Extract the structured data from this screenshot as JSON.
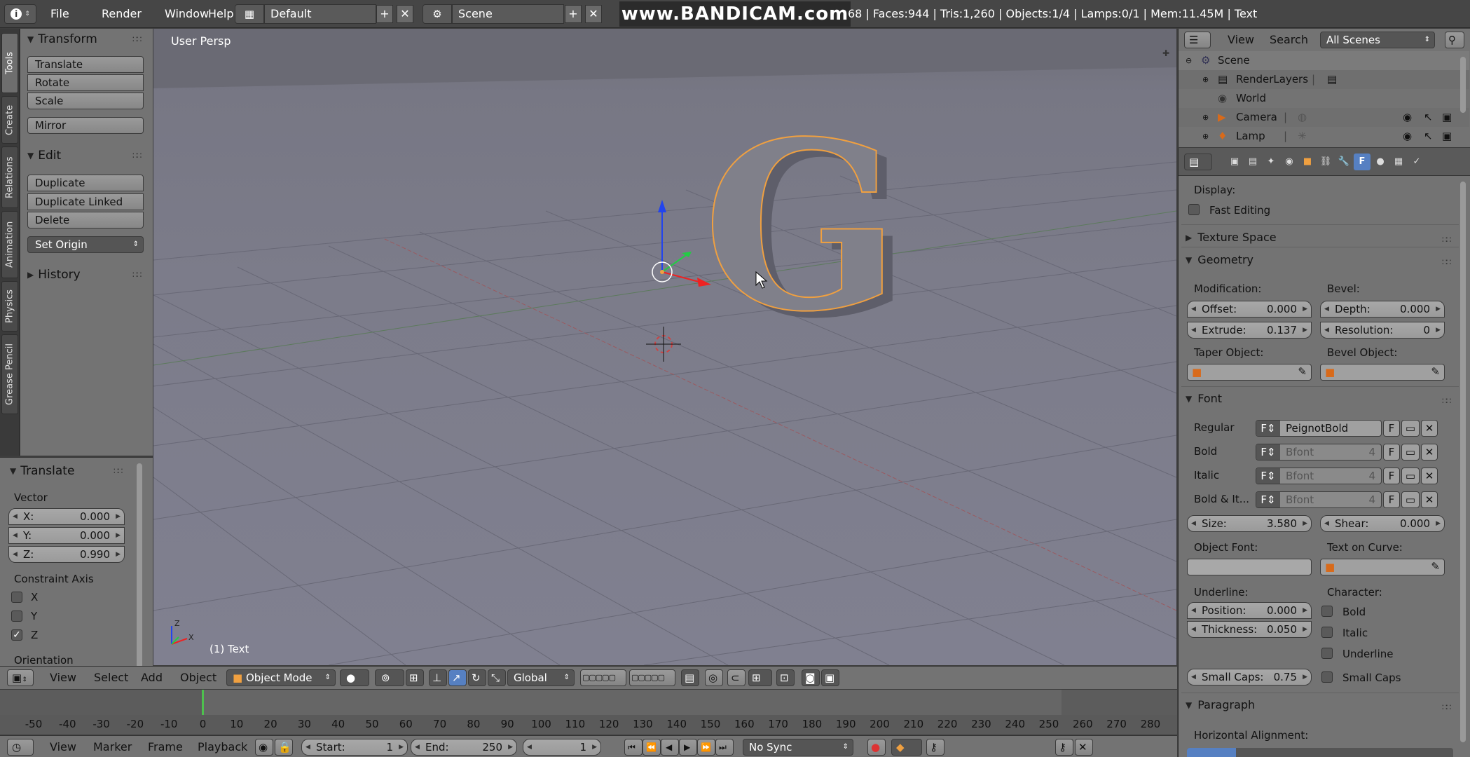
{
  "topbar": {
    "info_icon": "info-icon",
    "menus": [
      "File",
      "Render",
      "Window",
      "Help"
    ],
    "layout_name": "Default",
    "scene_name": "Scene",
    "watermark": "www.BANDICAM.com",
    "stats": "68 | Faces:944 | Tris:1,260 | Objects:1/4 | Lamps:0/1 | Mem:11.45M | Text"
  },
  "tooltabs": [
    "Tools",
    "Create",
    "Relations",
    "Animation",
    "Physics",
    "Grease Pencil"
  ],
  "toolshelf": {
    "transform": {
      "title": "Transform",
      "buttons": [
        "Translate",
        "Rotate",
        "Scale"
      ],
      "mirror": "Mirror"
    },
    "edit": {
      "title": "Edit",
      "buttons": [
        "Duplicate",
        "Duplicate Linked",
        "Delete"
      ],
      "set_origin": "Set Origin"
    },
    "history": {
      "title": "History"
    }
  },
  "operator": {
    "title": "Translate",
    "vector_label": "Vector",
    "x": {
      "label": "X:",
      "value": "0.000"
    },
    "y": {
      "label": "Y:",
      "value": "0.000"
    },
    "z": {
      "label": "Z:",
      "value": "0.990"
    },
    "constraint_label": "Constraint Axis",
    "axes": [
      {
        "label": "X",
        "checked": false
      },
      {
        "label": "Y",
        "checked": false
      },
      {
        "label": "Z",
        "checked": true
      }
    ],
    "orientation_label": "Orientation"
  },
  "viewport": {
    "view_name": "User Persp",
    "object_label": "(1) Text",
    "letter": "G",
    "axis_label_z": "Z",
    "axis_label_x": "X"
  },
  "vphdr": {
    "menus": [
      "View",
      "Select",
      "Add",
      "Object"
    ],
    "mode": "Object Mode",
    "orientation": "Global"
  },
  "timeline": {
    "ticks": [
      "-50",
      "-40",
      "-30",
      "-20",
      "-10",
      "0",
      "10",
      "20",
      "30",
      "40",
      "50",
      "60",
      "70",
      "80",
      "90",
      "100",
      "110",
      "120",
      "130",
      "140",
      "150",
      "160",
      "170",
      "180",
      "190",
      "200",
      "210",
      "220",
      "230",
      "240",
      "250",
      "260",
      "270",
      "280"
    ],
    "menus": [
      "View",
      "Marker",
      "Frame",
      "Playback"
    ],
    "start_label": "Start:",
    "start_value": "1",
    "end_label": "End:",
    "end_value": "250",
    "current_frame": "1",
    "sync": "No Sync"
  },
  "outliner": {
    "menus": [
      "View",
      "Search"
    ],
    "scenes": "All Scenes",
    "rows": [
      "Scene",
      "RenderLayers",
      "World",
      "Camera",
      "Lamp"
    ]
  },
  "properties": {
    "display_label": "Display:",
    "fast_editing": "Fast Editing",
    "texture_space": "Texture Space",
    "geometry": {
      "title": "Geometry",
      "modification": "Modification:",
      "bevel": "Bevel:",
      "offset": {
        "label": "Offset:",
        "value": "0.000"
      },
      "depth": {
        "label": "Depth:",
        "value": "0.000"
      },
      "extrude": {
        "label": "Extrude:",
        "value": "0.137"
      },
      "resolution": {
        "label": "Resolution:",
        "value": "0"
      },
      "taper": "Taper Object:",
      "bevel_obj": "Bevel Object:"
    },
    "font": {
      "title": "Font",
      "rows": [
        {
          "label": "Regular",
          "name": "PeignotBold",
          "count": "",
          "f": "F"
        },
        {
          "label": "Bold",
          "name": "Bfont",
          "count": "4",
          "f": "F"
        },
        {
          "label": "Italic",
          "name": "Bfont",
          "count": "4",
          "f": "F"
        },
        {
          "label": "Bold & It...",
          "name": "Bfont",
          "count": "4",
          "f": "F"
        }
      ],
      "size": {
        "label": "Size:",
        "value": "3.580"
      },
      "shear": {
        "label": "Shear:",
        "value": "0.000"
      },
      "object_font": "Object Font:",
      "text_on_curve": "Text on Curve:",
      "underline": "Underline:",
      "character": "Character:",
      "position": {
        "label": "Position:",
        "value": "0.000"
      },
      "thickness": {
        "label": "Thickness:",
        "value": "0.050"
      },
      "small_caps": {
        "label": "Small Caps:",
        "value": "0.75"
      },
      "char_checks": [
        "Bold",
        "Italic",
        "Underline",
        "Small Caps"
      ]
    },
    "paragraph": {
      "title": "Paragraph",
      "h_align": "Horizontal Alignment:"
    }
  },
  "colors": {
    "accent": "#5680c2",
    "selection": "#f0a040",
    "background": "#737373"
  }
}
